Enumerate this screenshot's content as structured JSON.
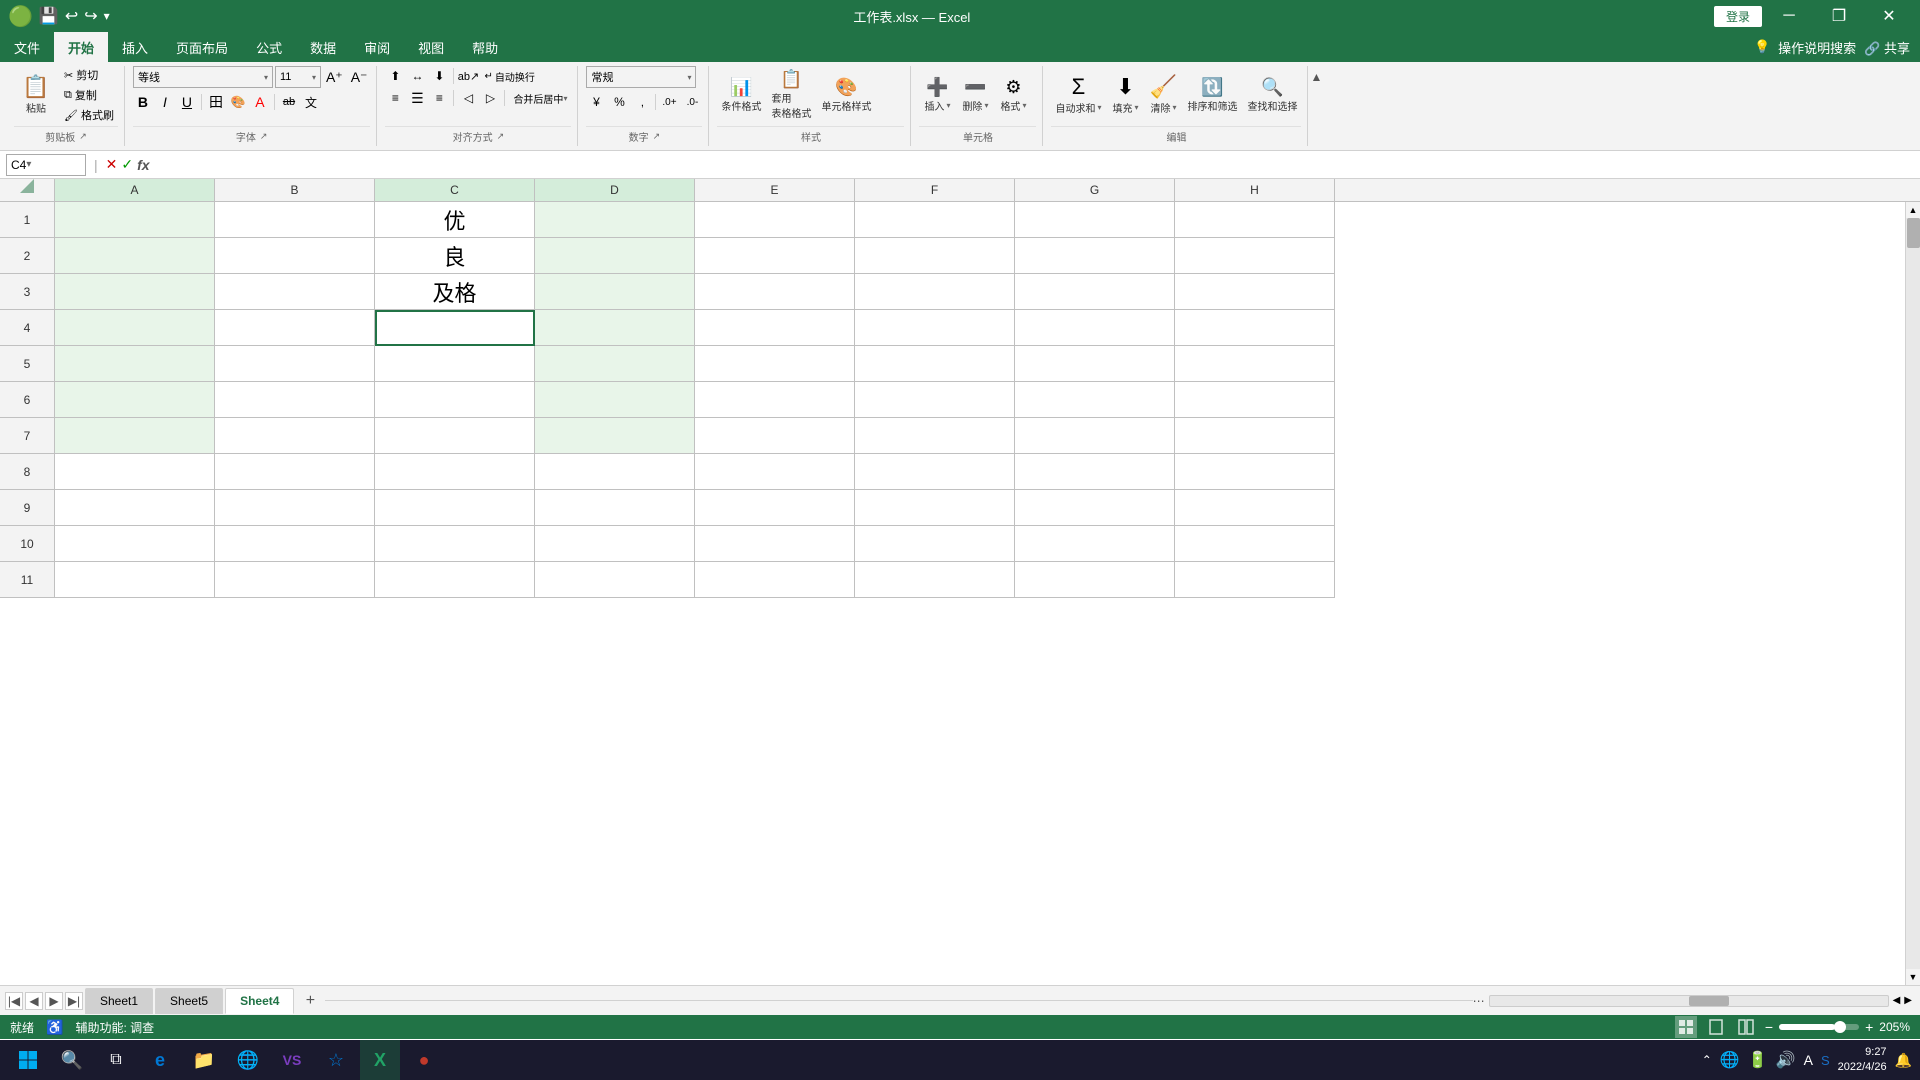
{
  "titlebar": {
    "title": "工作表.xlsx — Excel",
    "login_label": "登录",
    "save_icon": "💾",
    "undo_icon": "↩",
    "redo_icon": "↪",
    "customize_icon": "▾",
    "minimize_icon": "─",
    "restore_icon": "❐",
    "close_icon": "✕"
  },
  "ribbon": {
    "tabs": [
      {
        "id": "file",
        "label": "文件"
      },
      {
        "id": "home",
        "label": "开始",
        "active": true
      },
      {
        "id": "insert",
        "label": "插入"
      },
      {
        "id": "layout",
        "label": "页面布局"
      },
      {
        "id": "formula",
        "label": "公式"
      },
      {
        "id": "data",
        "label": "数据"
      },
      {
        "id": "review",
        "label": "审阅"
      },
      {
        "id": "view",
        "label": "视图"
      },
      {
        "id": "help",
        "label": "帮助"
      }
    ],
    "search_placeholder": "操作说明搜索",
    "share_label": "共享",
    "groups": {
      "clipboard": {
        "label": "剪贴板",
        "paste_label": "粘贴",
        "cut_label": "剪切",
        "copy_label": "复制",
        "format_painter_label": "格式刷"
      },
      "font": {
        "label": "字体",
        "font_name": "等线",
        "font_size": "11",
        "bold_label": "B",
        "italic_label": "I",
        "underline_label": "U",
        "border_label": "田",
        "fill_label": "A",
        "color_label": "A",
        "increase_font": "A↑",
        "decrease_font": "A↓",
        "strikethrough": "ab",
        "phonetic": "文"
      },
      "alignment": {
        "label": "对齐方式",
        "wrap_text": "自动换行",
        "merge_center": "合并后居中",
        "align_top": "⊤",
        "align_mid": "≡",
        "align_bot": "⊥",
        "align_left": "≡",
        "align_center": "≡",
        "align_right": "≡",
        "indent_dec": "◁",
        "indent_inc": "▷",
        "orientation": "ab↗"
      },
      "number": {
        "label": "数字",
        "format": "常规",
        "percent": "%",
        "comma": ",",
        "increase_dec": ".0→",
        "decrease_dec": "←.0",
        "currency": "¥"
      },
      "styles": {
        "label": "样式",
        "conditional": "条件格式",
        "table_format": "套用\n表格格式",
        "cell_styles": "单元格样式"
      },
      "cells": {
        "label": "单元格",
        "insert": "插入",
        "delete": "删除",
        "format": "格式"
      },
      "editing": {
        "label": "编辑",
        "sum": "Σ",
        "fill": "↓",
        "clear": "🧹",
        "sort_filter": "排序和筛选",
        "find_select": "查找和选择"
      }
    }
  },
  "formula_bar": {
    "cell_ref": "C4",
    "cancel_icon": "✕",
    "confirm_icon": "✓",
    "function_icon": "fx",
    "formula_value": ""
  },
  "spreadsheet": {
    "columns": [
      "A",
      "B",
      "C",
      "D",
      "E",
      "F",
      "G",
      "H"
    ],
    "rows": [
      1,
      2,
      3,
      4,
      5,
      6,
      7,
      8,
      9,
      10,
      11
    ],
    "cells": {
      "C1": {
        "value": "优",
        "bg": ""
      },
      "C2": {
        "value": "良",
        "bg": ""
      },
      "C3": {
        "value": "及格",
        "bg": ""
      }
    },
    "highlighted_cols": [
      "A",
      "C",
      "D"
    ],
    "selected_cell": "C4",
    "light_green_a_rows": [
      1,
      2,
      3,
      4,
      5,
      6,
      7
    ],
    "light_green_cd_rows": [
      1,
      2,
      3,
      4,
      5,
      6,
      7
    ]
  },
  "sheet_tabs": {
    "sheets": [
      {
        "id": "sheet1",
        "label": "Sheet1"
      },
      {
        "id": "sheet5",
        "label": "Sheet5"
      },
      {
        "id": "sheet4",
        "label": "Sheet4",
        "active": true
      }
    ],
    "add_label": "+"
  },
  "status_bar": {
    "ready_label": "就绪",
    "accessibility_label": "辅助功能: 调查",
    "zoom_percent": "205%",
    "zoom_value": 205
  },
  "taskbar": {
    "start_icon": "⊞",
    "search_icon": "🔍",
    "taskview_icon": "⧉",
    "edge_icon": "e",
    "file_icon": "📁",
    "browser_icon": "🌐",
    "vs_icon": "VS",
    "app1_icon": "☆",
    "excel_icon": "X",
    "app2_icon": "●",
    "time": "9:27",
    "date": "2022/4/26",
    "notification_icon": "🔔"
  }
}
